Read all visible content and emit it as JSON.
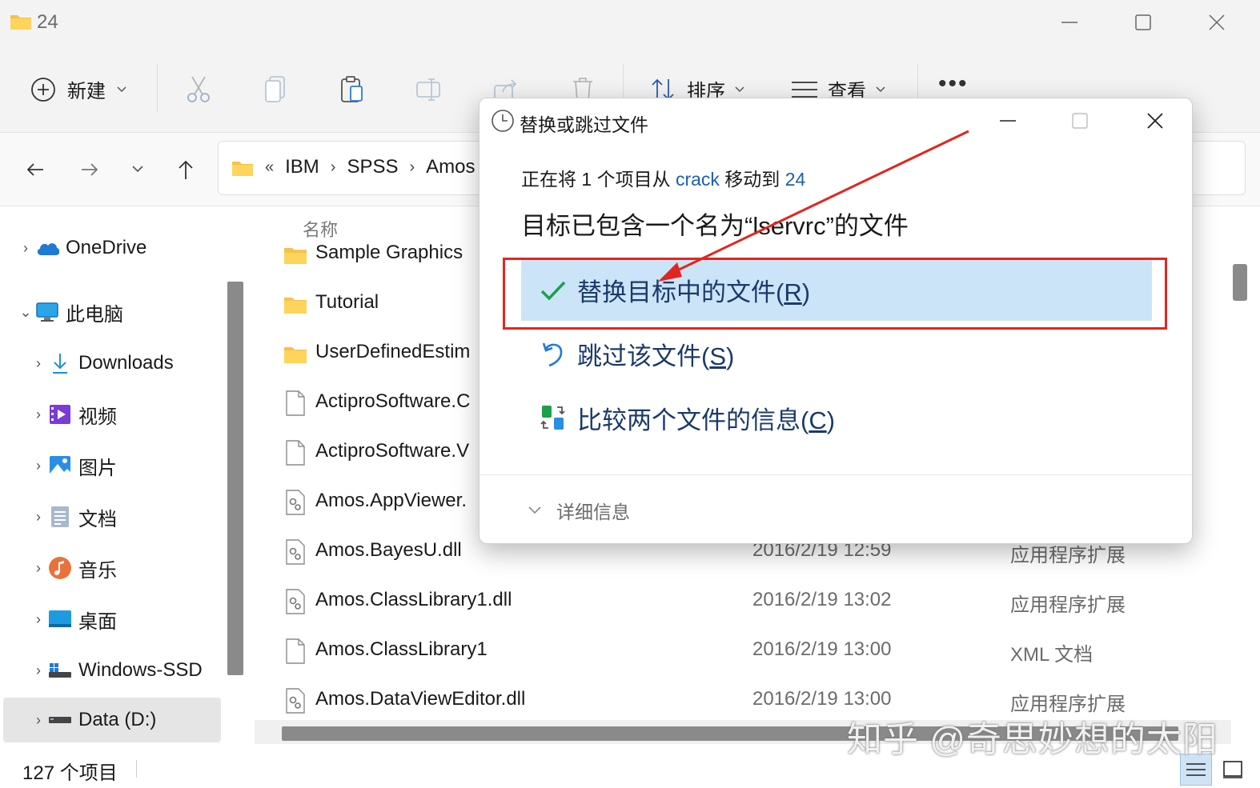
{
  "window": {
    "title": "24"
  },
  "toolbar": {
    "new_label": "新建",
    "sort_label": "排序",
    "view_label": "查看",
    "more_label": "•••"
  },
  "address": {
    "crumbs": [
      "IBM",
      "SPSS",
      "Amos"
    ],
    "overflow": "«"
  },
  "nav": {
    "items": [
      {
        "label": "OneDrive",
        "icon": "onedrive-icon"
      },
      {
        "label": "此电脑",
        "icon": "computer-icon"
      },
      {
        "label": "Downloads",
        "icon": "download-icon"
      },
      {
        "label": "视频",
        "icon": "video-icon"
      },
      {
        "label": "图片",
        "icon": "pictures-icon"
      },
      {
        "label": "文档",
        "icon": "documents-icon"
      },
      {
        "label": "音乐",
        "icon": "music-icon"
      },
      {
        "label": "桌面",
        "icon": "desktop-icon"
      },
      {
        "label": "Windows-SSD",
        "icon": "drive-icon"
      },
      {
        "label": "Data (D:)",
        "icon": "drive-icon"
      }
    ]
  },
  "content": {
    "column_name": "名称",
    "files": [
      {
        "name": "Sample Graphics",
        "date": "",
        "type": "",
        "icon": "folder"
      },
      {
        "name": "Tutorial",
        "date": "",
        "type": "",
        "icon": "folder"
      },
      {
        "name": "UserDefinedEstim",
        "date": "",
        "type": "",
        "icon": "folder"
      },
      {
        "name": "ActiproSoftware.C",
        "date": "",
        "type": "",
        "icon": "file"
      },
      {
        "name": "ActiproSoftware.V",
        "date": "",
        "type": "",
        "icon": "file"
      },
      {
        "name": "Amos.AppViewer.",
        "date": "",
        "type": "",
        "icon": "dll"
      },
      {
        "name": "Amos.BayesU.dll",
        "date": "2016/2/19 12:59",
        "type": "应用程序扩展",
        "icon": "dll"
      },
      {
        "name": "Amos.ClassLibrary1.dll",
        "date": "2016/2/19 13:02",
        "type": "应用程序扩展",
        "icon": "dll"
      },
      {
        "name": "Amos.ClassLibrary1",
        "date": "2016/2/19 13:00",
        "type": "XML 文档",
        "icon": "file"
      },
      {
        "name": "Amos.DataViewEditor.dll",
        "date": "2016/2/19 13:00",
        "type": "应用程序扩展",
        "icon": "dll"
      }
    ]
  },
  "status": {
    "count_text": "127 个项目"
  },
  "watermark": "知乎 @奇思妙想的太阳",
  "dialog": {
    "title": "替换或跳过文件",
    "line1_prefix": "正在将 1 个项目从 ",
    "line1_source": "crack",
    "line1_middle": " 移动到 ",
    "line1_dest": "24",
    "line2": "目标已包含一个名为“lservrc”的文件",
    "opt_replace_text": "替换目标中的文件(",
    "opt_replace_key": "R",
    "opt_skip_text": "跳过该文件(",
    "opt_skip_key": "S",
    "opt_compare_text": "比较两个文件的信息(",
    "opt_compare_key": "C",
    "close_paren": ")",
    "details_label": "详细信息"
  },
  "colors": {
    "highlight": "#cce4f7",
    "annotation_red": "#e2261f",
    "link": "#1a5fb4"
  }
}
